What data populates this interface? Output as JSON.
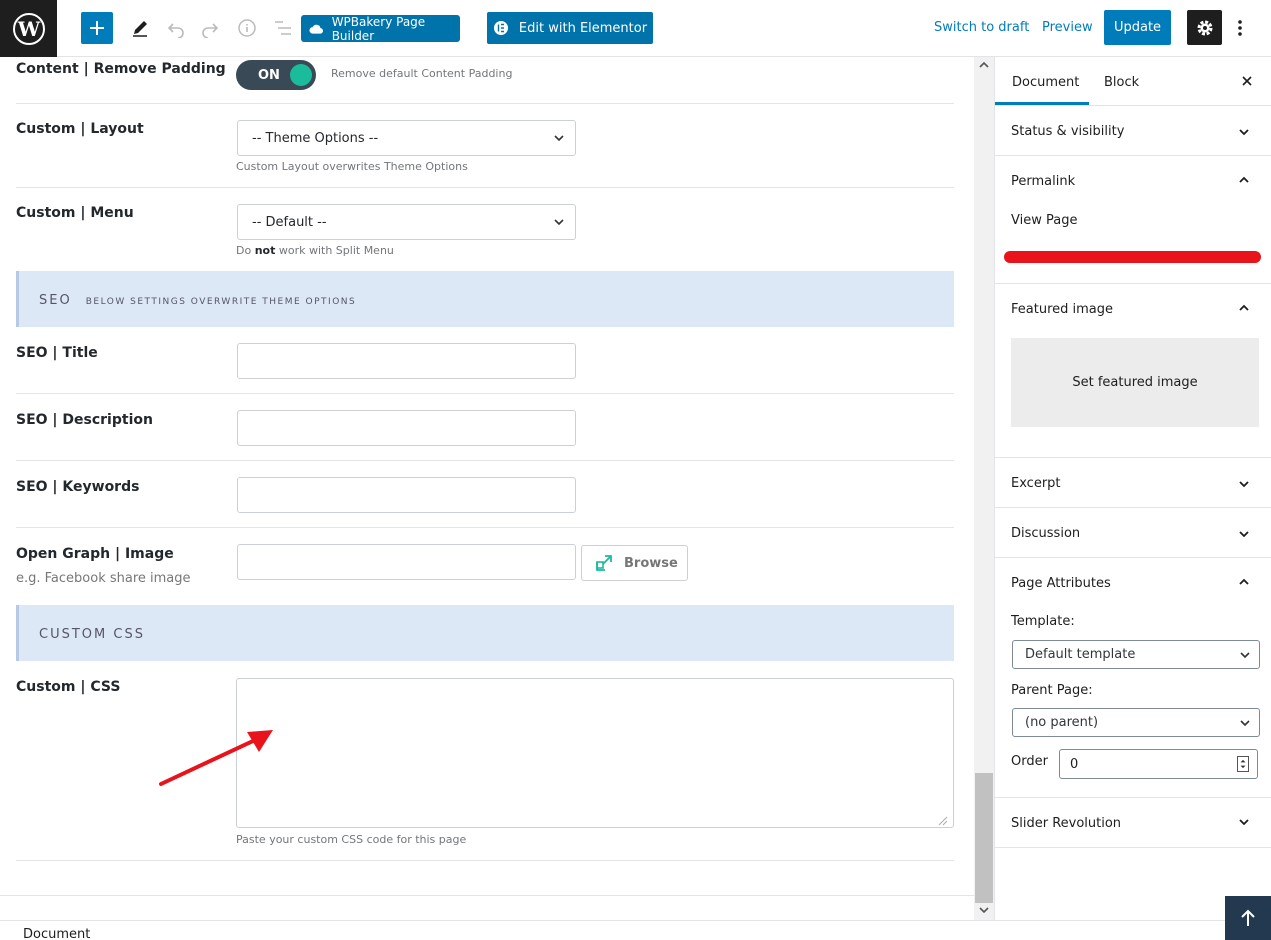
{
  "toolbar": {
    "wpbakery_label": "WPBakery Page Builder",
    "elementor_label": "Edit with Elementor",
    "switch_to_draft": "Switch to draft",
    "preview": "Preview",
    "update": "Update"
  },
  "content": {
    "remove_padding": {
      "label": "Content | Remove Padding",
      "toggle": "ON",
      "hint": "Remove default Content Padding"
    },
    "layout": {
      "label": "Custom | Layout",
      "value": "-- Theme Options --",
      "hint": "Custom Layout overwrites Theme Options"
    },
    "menu": {
      "label": "Custom | Menu",
      "value": "-- Default --",
      "hint_pre": "Do ",
      "hint_bold": "not",
      "hint_post": " work with Split Menu"
    },
    "seo_section": {
      "title": "SEO",
      "subtitle": "BELOW SETTINGS OVERWRITE THEME OPTIONS"
    },
    "seo_title": {
      "label": "SEO | Title",
      "value": ""
    },
    "seo_description": {
      "label": "SEO | Description",
      "value": ""
    },
    "seo_keywords": {
      "label": "SEO | Keywords",
      "value": ""
    },
    "og_image": {
      "label": "Open Graph | Image",
      "sublabel": "e.g. Facebook share image",
      "value": "",
      "browse": "Browse"
    },
    "css_section": {
      "title": "CUSTOM CSS"
    },
    "custom_css": {
      "label": "Custom | CSS",
      "value": "",
      "hint": "Paste your custom CSS code for this page"
    }
  },
  "sidebar": {
    "tabs": [
      "Document",
      "Block"
    ],
    "active_tab": "Document",
    "panels": {
      "status": "Status & visibility",
      "permalink": "Permalink",
      "view_page": "View Page",
      "featured": "Featured image",
      "set_featured": "Set featured image",
      "excerpt": "Excerpt",
      "discussion": "Discussion",
      "page_attributes": "Page Attributes",
      "template_label": "Template:",
      "template_value": "Default template",
      "parent_label": "Parent Page:",
      "parent_value": "(no parent)",
      "order_label": "Order",
      "order_value": "0",
      "slider": "Slider Revolution"
    }
  },
  "footer": {
    "breadcrumb": "Document"
  },
  "colors": {
    "accent": "#007cba",
    "toggle_on": "#1abc9c",
    "section_band": "#dde8f7",
    "annotation_red": "#e8131b"
  }
}
